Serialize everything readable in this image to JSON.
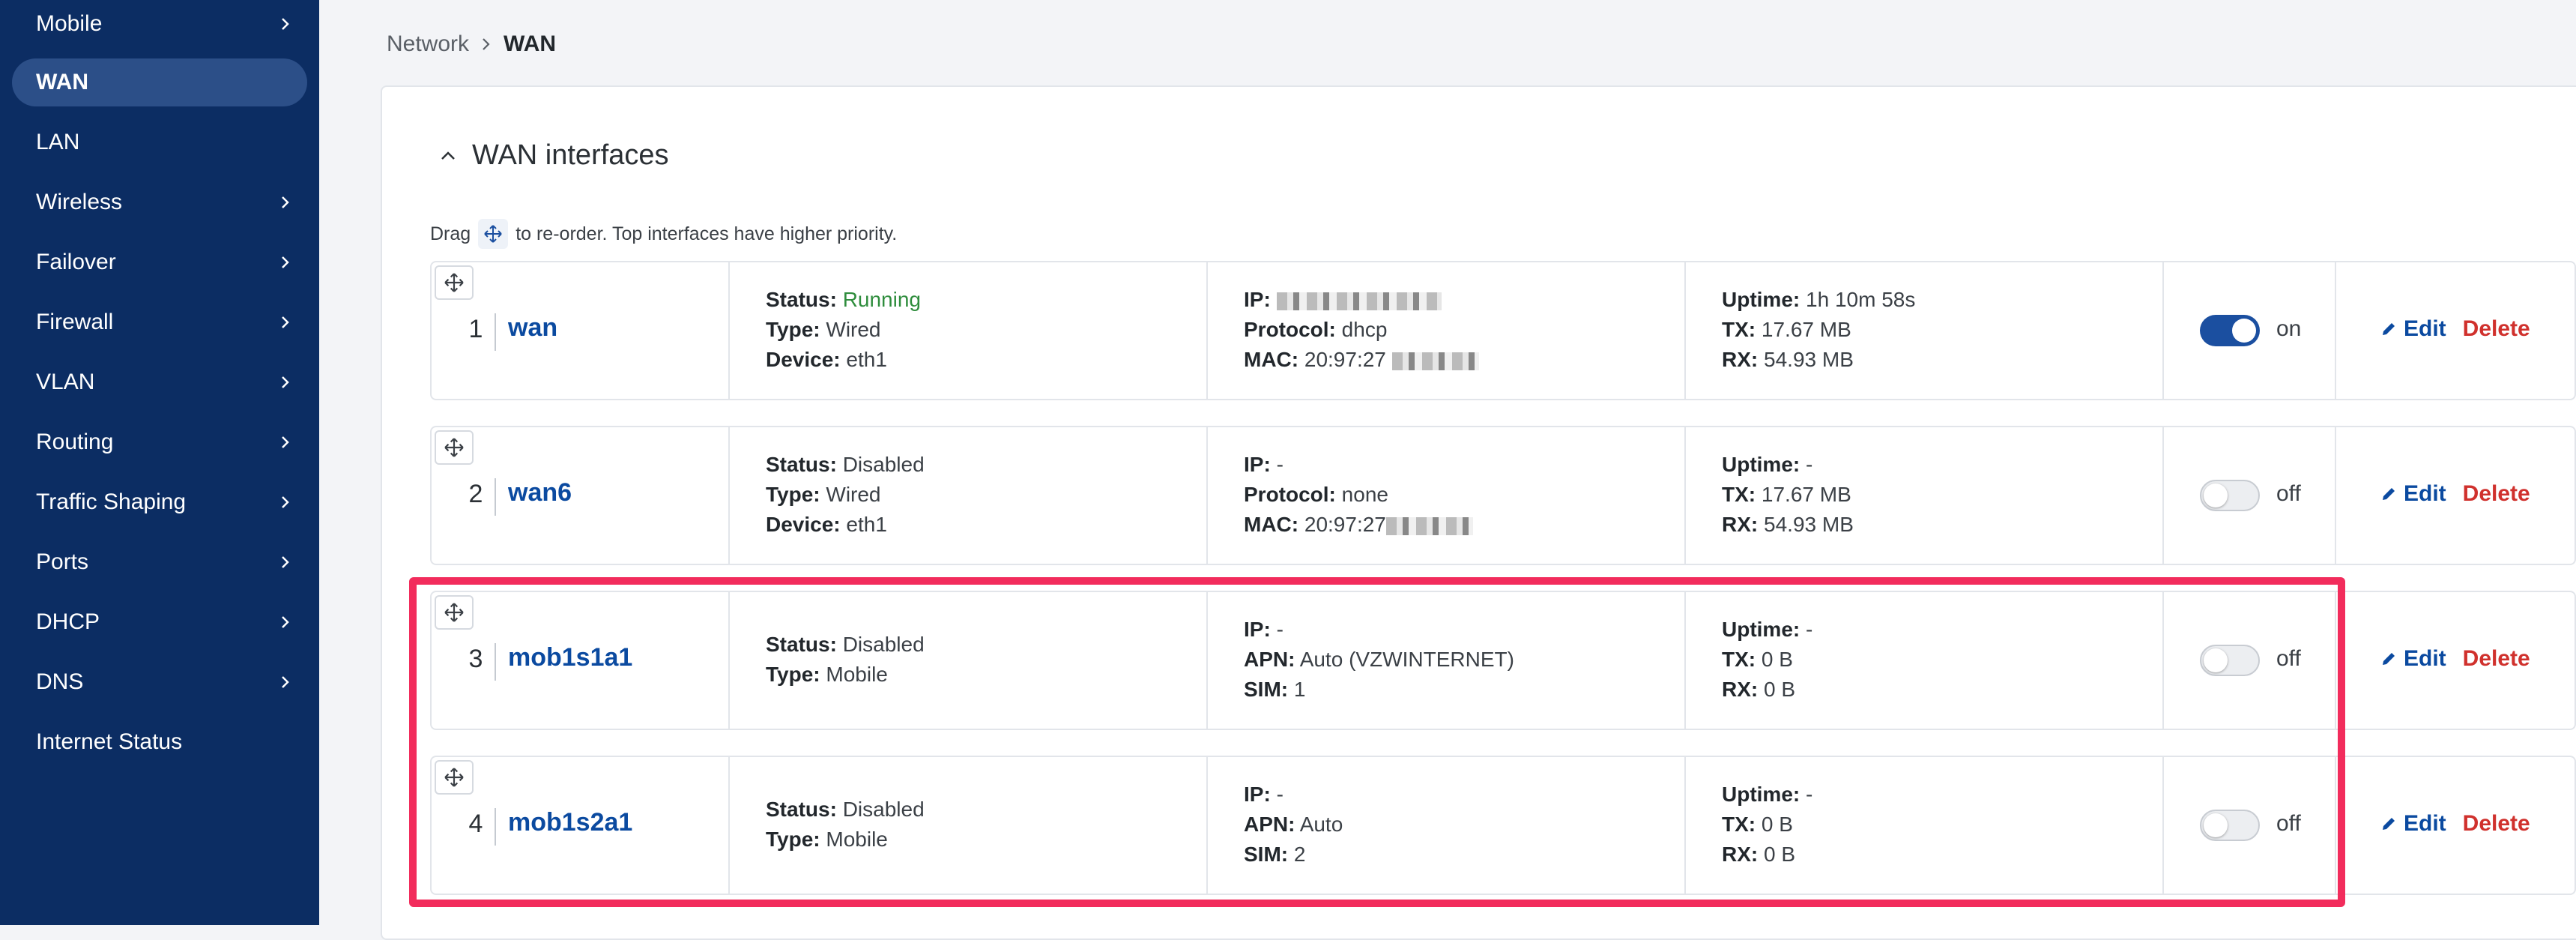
{
  "sidebar": {
    "items": [
      {
        "label": "Mobile",
        "has_submenu": true
      },
      {
        "label": "WAN",
        "has_submenu": false,
        "active": true
      },
      {
        "label": "LAN",
        "has_submenu": false
      },
      {
        "label": "Wireless",
        "has_submenu": true
      },
      {
        "label": "Failover",
        "has_submenu": true
      },
      {
        "label": "Firewall",
        "has_submenu": true
      },
      {
        "label": "VLAN",
        "has_submenu": true
      },
      {
        "label": "Routing",
        "has_submenu": true
      },
      {
        "label": "Traffic Shaping",
        "has_submenu": true
      },
      {
        "label": "Ports",
        "has_submenu": true
      },
      {
        "label": "DHCP",
        "has_submenu": true
      },
      {
        "label": "DNS",
        "has_submenu": true
      },
      {
        "label": "Internet Status",
        "has_submenu": false
      }
    ]
  },
  "breadcrumb": {
    "parent": "Network",
    "current": "WAN"
  },
  "section": {
    "title": "WAN interfaces",
    "hint_before": "Drag",
    "hint_after": "to re-order. Top interfaces have higher priority."
  },
  "labels": {
    "status": "Status:",
    "type": "Type:",
    "device": "Device:",
    "ip": "IP:",
    "protocol": "Protocol:",
    "mac": "MAC:",
    "apn": "APN:",
    "sim": "SIM:",
    "uptime": "Uptime:",
    "tx": "TX:",
    "rx": "RX:",
    "edit": "Edit",
    "delete": "Delete"
  },
  "interfaces": [
    {
      "index": "1",
      "name": "wan",
      "status": "Running",
      "type": "Wired",
      "device": "eth1",
      "ip": "",
      "protocol": "dhcp",
      "mac": "20:97:27",
      "uptime": "1h 10m 58s",
      "tx": "17.67 MB",
      "rx": "54.93 MB",
      "toggle": "on"
    },
    {
      "index": "2",
      "name": "wan6",
      "status": "Disabled",
      "type": "Wired",
      "device": "eth1",
      "ip": "-",
      "protocol": "none",
      "mac": "20:97:27",
      "uptime": "-",
      "tx": "17.67 MB",
      "rx": "54.93 MB",
      "toggle": "off"
    },
    {
      "index": "3",
      "name": "mob1s1a1",
      "status": "Disabled",
      "type": "Mobile",
      "ip": "-",
      "apn": "Auto (VZWINTERNET)",
      "sim": "1",
      "uptime": "-",
      "tx": "0 B",
      "rx": "0 B",
      "toggle": "off"
    },
    {
      "index": "4",
      "name": "mob1s2a1",
      "status": "Disabled",
      "type": "Mobile",
      "ip": "-",
      "apn": "Auto",
      "sim": "2",
      "uptime": "-",
      "tx": "0 B",
      "rx": "0 B",
      "toggle": "off"
    }
  ],
  "colors": {
    "sidebar": "#0c2d63",
    "accent": "#0b4aa0",
    "running": "#2f8d3d",
    "delete": "#d0312d",
    "highlight": "#f22c5c"
  }
}
